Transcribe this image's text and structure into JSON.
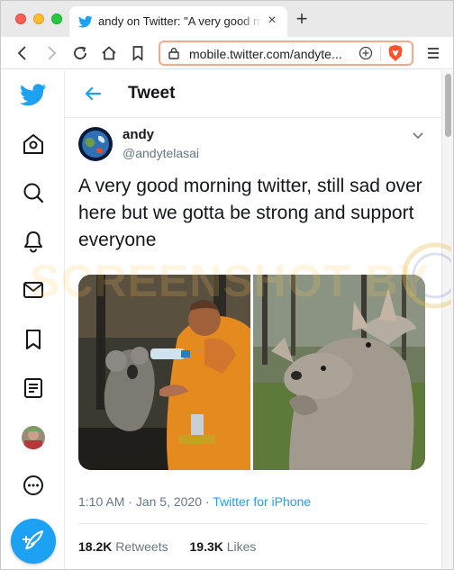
{
  "browser": {
    "tab_title": "andy on Twitter: \"A very good morning twitter, still sad",
    "new_tab_symbol": "+",
    "tab_close_symbol": "×",
    "url": "mobile.twitter.com/andyte...",
    "accent_color": "#f3a98f"
  },
  "twitter": {
    "header_title": "Tweet",
    "brand_color": "#1da1f2",
    "nav_icons": [
      "twitter-logo-icon",
      "home-icon",
      "explore-search-icon",
      "notifications-bell-icon",
      "messages-mail-icon",
      "bookmarks-icon",
      "lists-icon",
      "profile-avatar",
      "more-icon",
      "compose-tweet-icon"
    ]
  },
  "tweet": {
    "name": "andy",
    "handle": "@andytelasai",
    "text": "A very good morning twitter, still sad over here but we gotta be strong and support everyone",
    "time": "1:10 AM",
    "date": "Jan 5, 2020",
    "separator": "·",
    "source": "Twitter for iPhone",
    "retweets_count": "18.2K",
    "retweets_label": "Retweets",
    "likes_count": "19.3K",
    "likes_label": "Likes",
    "media": [
      "koala-drinking-water-photo",
      "kangaroo-hugging-photo"
    ]
  }
}
